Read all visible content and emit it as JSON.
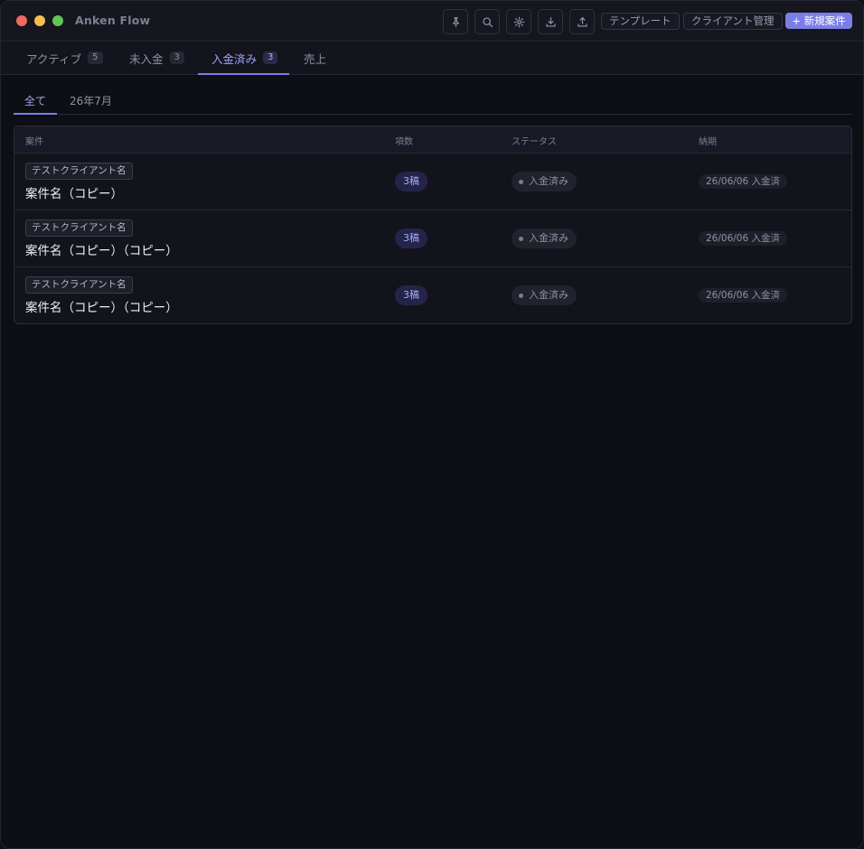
{
  "app": {
    "title": "Anken Flow"
  },
  "toolbar": {
    "icons": [
      "pin-icon",
      "search-icon",
      "gear-icon",
      "download-icon",
      "upload-icon"
    ],
    "template_label": "テンプレート",
    "client_mgmt_label": "クライアント管理",
    "new_project_label": "+ 新規案件"
  },
  "tabs": [
    {
      "label": "アクティブ",
      "count": "5"
    },
    {
      "label": "未入金",
      "count": "3"
    },
    {
      "label": "入金済み",
      "count": "3"
    },
    {
      "label": "売上",
      "count": ""
    }
  ],
  "active_tab": 2,
  "subtabs": [
    {
      "label": "全て"
    },
    {
      "label": "26年7月"
    }
  ],
  "table": {
    "headers": [
      "案件",
      "項数",
      "ステータス",
      "納期"
    ],
    "rows": [
      {
        "client": "テストクライアント名",
        "name": "案件名（コピー）",
        "count": "3稿",
        "status": "入金済み",
        "due": "26/06/06 入金済"
      },
      {
        "client": "テストクライアント名",
        "name": "案件名（コピー）（コピー）",
        "count": "3稿",
        "status": "入金済み",
        "due": "26/06/06 入金済"
      },
      {
        "client": "テストクライアント名",
        "name": "案件名（コピー）（コピー）",
        "count": "3稿",
        "status": "入金済み",
        "due": "26/06/06 入金済"
      }
    ]
  },
  "colors": {
    "accent": "#7b7ee6",
    "background": "#0e0f14",
    "surface": "#13141b"
  }
}
